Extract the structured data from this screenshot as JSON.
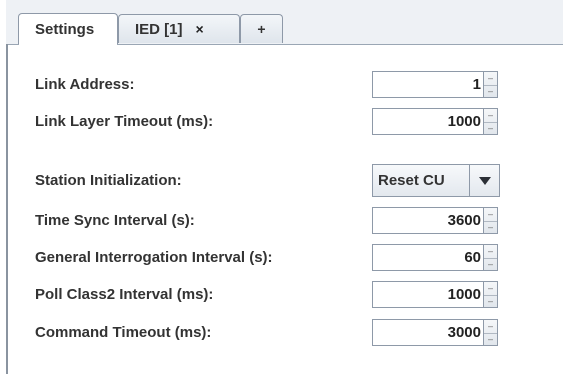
{
  "tabs": [
    {
      "label": "Settings",
      "active": true
    },
    {
      "label": "IED [1]",
      "close": "×"
    },
    {
      "label": "+"
    }
  ],
  "fields": {
    "link_address": {
      "label": "Link Address:",
      "value": "1"
    },
    "link_layer_timeout": {
      "label": "Link Layer Timeout (ms):",
      "value": "1000"
    },
    "station_init": {
      "label": "Station Initialization:",
      "value": "Reset CU"
    },
    "time_sync": {
      "label": "Time Sync Interval (s):",
      "value": "3600"
    },
    "general_interrogation": {
      "label": "General Interrogation Interval (s):",
      "value": "60"
    },
    "poll_class2": {
      "label": "Poll Class2 Interval (ms):",
      "value": "1000"
    },
    "command_timeout": {
      "label": "Command Timeout (ms):",
      "value": "3000"
    }
  },
  "icons": {
    "spin_up": "spinner-up-icon",
    "spin_down": "spinner-down-icon",
    "dropdown": "chevron-down-icon"
  }
}
